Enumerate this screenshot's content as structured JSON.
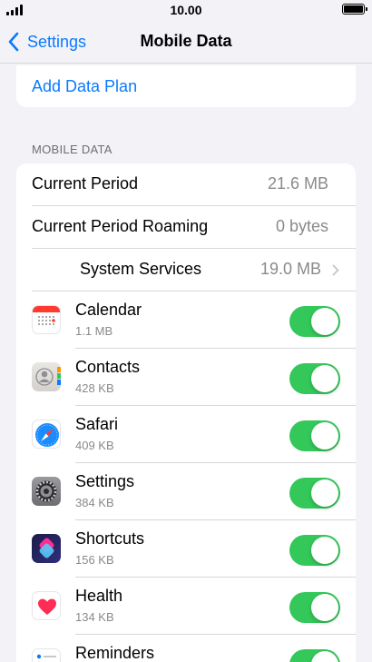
{
  "status_bar": {
    "time": "10.00",
    "signal_icon": "signal-bars-icon",
    "battery_icon": "battery-full-icon"
  },
  "nav": {
    "back_label": "Settings",
    "title": "Mobile Data"
  },
  "plan": {
    "add_label": "Add Data Plan"
  },
  "section": {
    "header": "MOBILE DATA"
  },
  "summary": {
    "current_period_label": "Current Period",
    "current_period_value": "21.6 MB",
    "roaming_label": "Current Period Roaming",
    "roaming_value": "0 bytes",
    "system_services_label": "System Services",
    "system_services_value": "19.0 MB"
  },
  "apps": [
    {
      "name": "Calendar",
      "size": "1.1 MB",
      "icon": "calendar-icon",
      "enabled": true
    },
    {
      "name": "Contacts",
      "size": "428 KB",
      "icon": "contacts-icon",
      "enabled": true
    },
    {
      "name": "Safari",
      "size": "409 KB",
      "icon": "safari-icon",
      "enabled": true
    },
    {
      "name": "Settings",
      "size": "384 KB",
      "icon": "settings-icon",
      "enabled": true
    },
    {
      "name": "Shortcuts",
      "size": "156 KB",
      "icon": "shortcuts-icon",
      "enabled": true
    },
    {
      "name": "Health",
      "size": "134 KB",
      "icon": "health-icon",
      "enabled": true
    },
    {
      "name": "Reminders",
      "size": "",
      "icon": "reminders-icon",
      "enabled": true
    }
  ],
  "colors": {
    "accent": "#0a7aff",
    "toggle_on": "#34c759"
  }
}
